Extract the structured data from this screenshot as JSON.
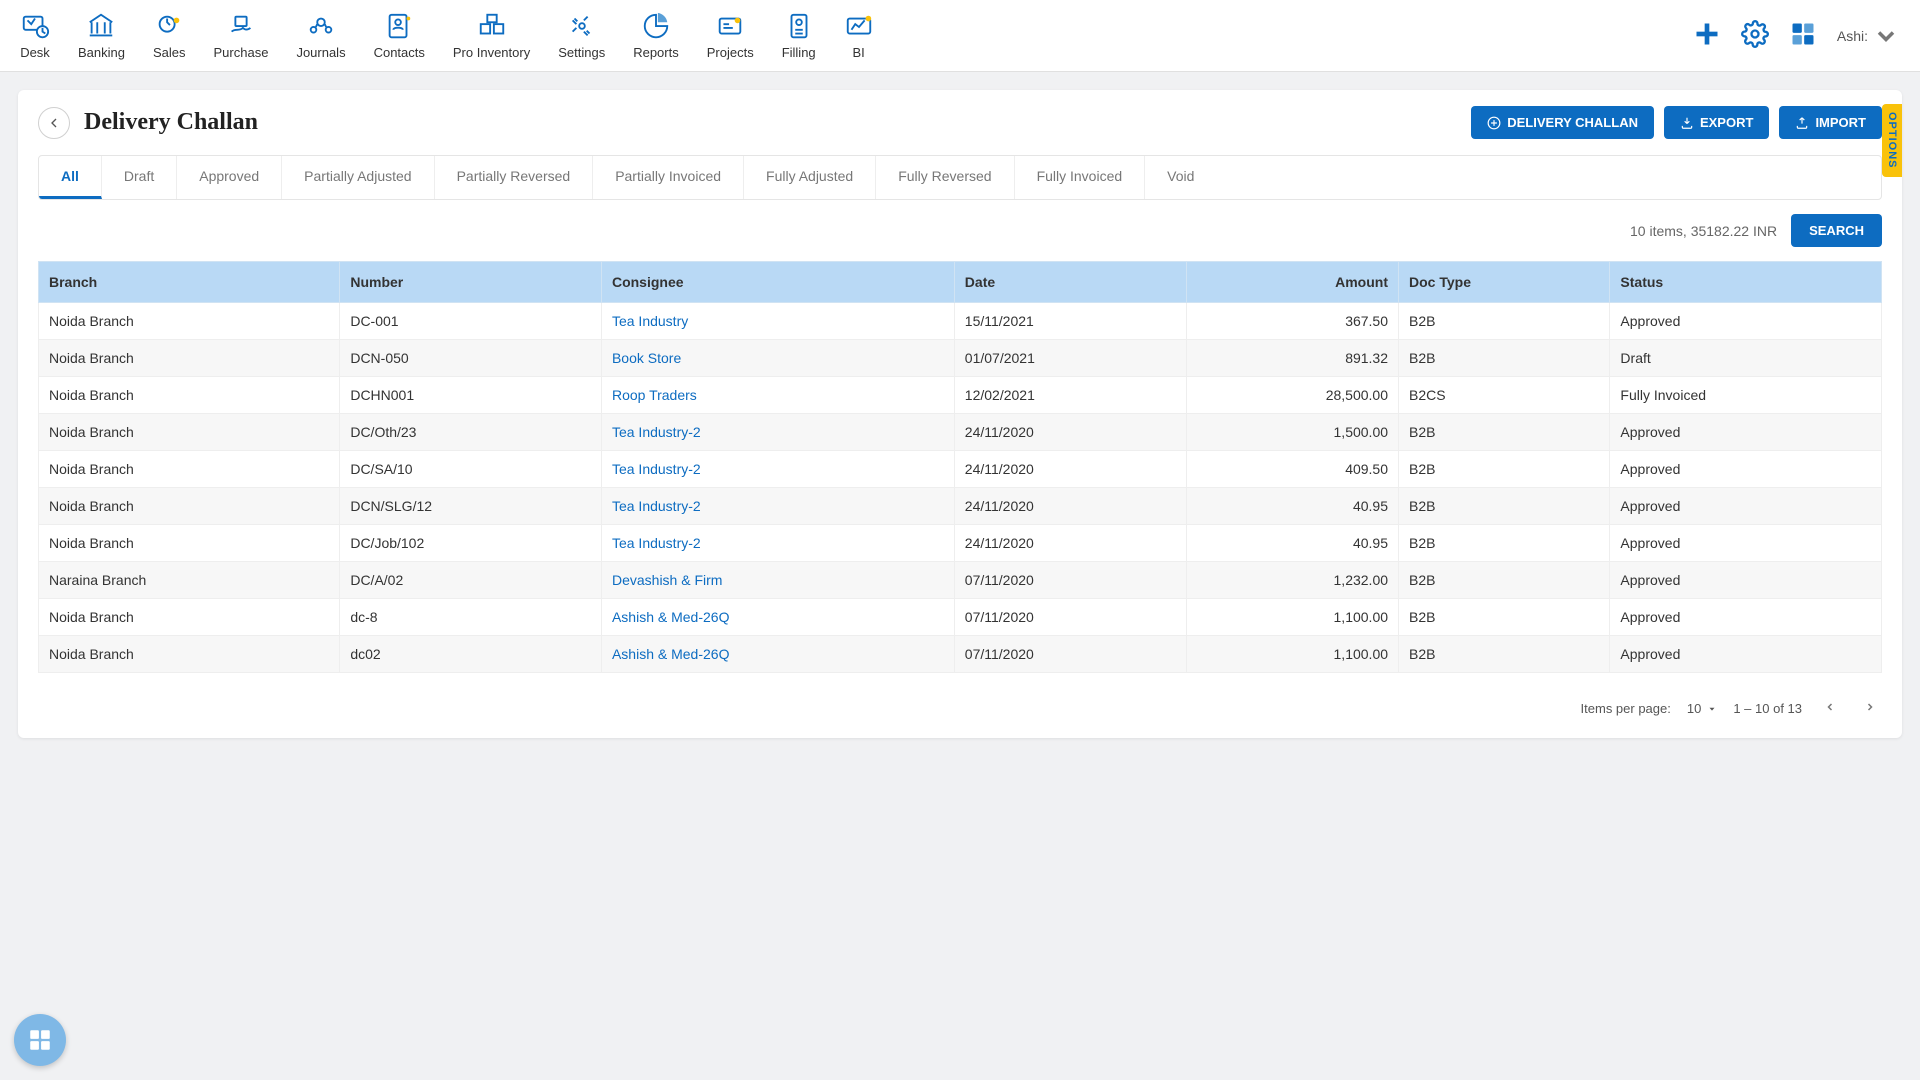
{
  "nav": {
    "items": [
      "Desk",
      "Banking",
      "Sales",
      "Purchase",
      "Journals",
      "Contacts",
      "Pro Inventory",
      "Settings",
      "Reports",
      "Projects",
      "Filling",
      "BI"
    ],
    "user": "Ashi:"
  },
  "header": {
    "title": "Delivery Challan",
    "actions": {
      "new": "DELIVERY CHALLAN",
      "export": "EXPORT",
      "import": "IMPORT"
    },
    "options": "OPTIONS"
  },
  "tabs": [
    "All",
    "Draft",
    "Approved",
    "Partially Adjusted",
    "Partially Reversed",
    "Partially Invoiced",
    "Fully Adjusted",
    "Fully Reversed",
    "Fully Invoiced",
    "Void"
  ],
  "active_tab": 0,
  "summary": "10 items, 35182.22 INR",
  "search_label": "SEARCH",
  "columns": [
    "Branch",
    "Number",
    "Consignee",
    "Date",
    "Amount",
    "Doc Type",
    "Status"
  ],
  "rows": [
    {
      "branch": "Noida Branch",
      "number": "DC-001",
      "consignee": "Tea Industry",
      "date": "15/11/2021",
      "amount": "367.50",
      "doctype": "B2B",
      "status": "Approved"
    },
    {
      "branch": "Noida Branch",
      "number": "DCN-050",
      "consignee": "Book Store",
      "date": "01/07/2021",
      "amount": "891.32",
      "doctype": "B2B",
      "status": "Draft"
    },
    {
      "branch": "Noida Branch",
      "number": "DCHN001",
      "consignee": "Roop Traders",
      "date": "12/02/2021",
      "amount": "28,500.00",
      "doctype": "B2CS",
      "status": "Fully Invoiced"
    },
    {
      "branch": "Noida Branch",
      "number": "DC/Oth/23",
      "consignee": "Tea Industry-2",
      "date": "24/11/2020",
      "amount": "1,500.00",
      "doctype": "B2B",
      "status": "Approved"
    },
    {
      "branch": "Noida Branch",
      "number": "DC/SA/10",
      "consignee": "Tea Industry-2",
      "date": "24/11/2020",
      "amount": "409.50",
      "doctype": "B2B",
      "status": "Approved"
    },
    {
      "branch": "Noida Branch",
      "number": "DCN/SLG/12",
      "consignee": "Tea Industry-2",
      "date": "24/11/2020",
      "amount": "40.95",
      "doctype": "B2B",
      "status": "Approved"
    },
    {
      "branch": "Noida Branch",
      "number": "DC/Job/102",
      "consignee": "Tea Industry-2",
      "date": "24/11/2020",
      "amount": "40.95",
      "doctype": "B2B",
      "status": "Approved"
    },
    {
      "branch": "Naraina Branch",
      "number": "DC/A/02",
      "consignee": "Devashish & Firm",
      "date": "07/11/2020",
      "amount": "1,232.00",
      "doctype": "B2B",
      "status": "Approved"
    },
    {
      "branch": "Noida Branch",
      "number": "dc-8",
      "consignee": "Ashish & Med-26Q",
      "date": "07/11/2020",
      "amount": "1,100.00",
      "doctype": "B2B",
      "status": "Approved"
    },
    {
      "branch": "Noida Branch",
      "number": "dc02",
      "consignee": "Ashish & Med-26Q",
      "date": "07/11/2020",
      "amount": "1,100.00",
      "doctype": "B2B",
      "status": "Approved"
    }
  ],
  "paginator": {
    "label": "Items per page:",
    "per_page": "10",
    "range": "1 – 10 of 13"
  }
}
